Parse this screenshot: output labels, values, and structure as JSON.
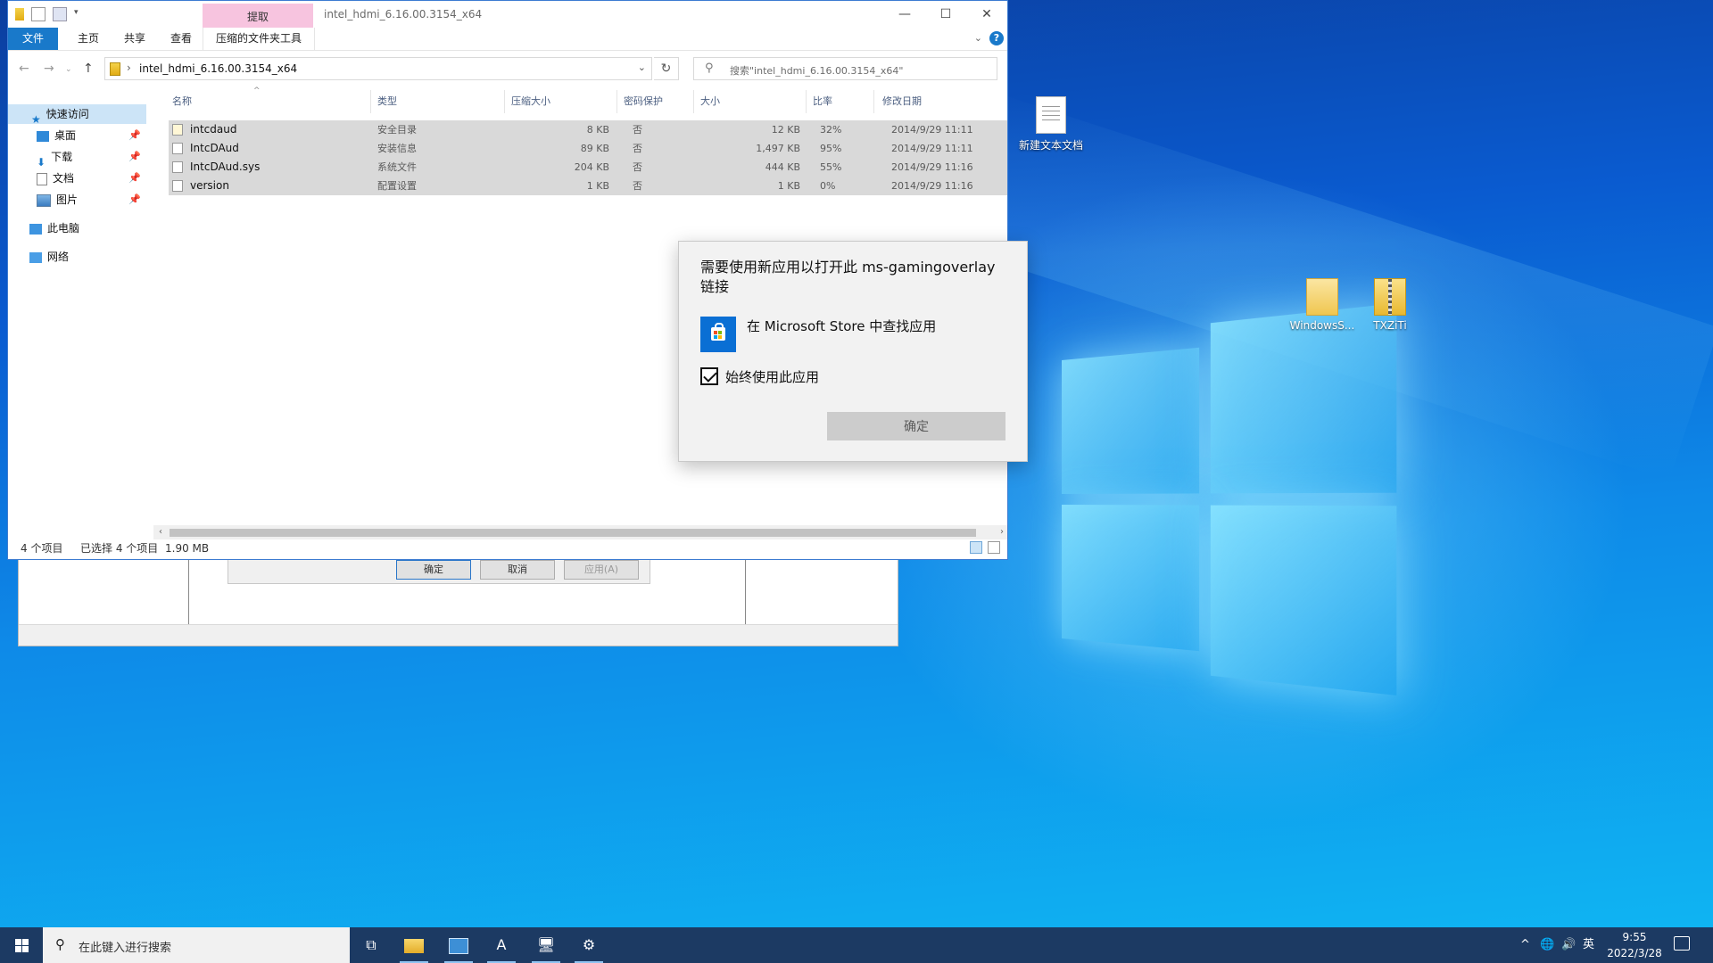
{
  "explorer": {
    "title": "intel_hdmi_6.16.00.3154_x64",
    "context_tab": "提取",
    "caption": {
      "minimize": "—",
      "maximize": "☐",
      "close": "✕"
    },
    "ribbon": {
      "file": "文件",
      "home": "主页",
      "share": "共享",
      "view": "查看",
      "compressed_tools": "压缩的文件夹工具",
      "help": "?"
    },
    "address": {
      "path": "intel_hdmi_6.16.00.3154_x64",
      "search_placeholder": "搜索\"intel_hdmi_6.16.00.3154_x64\""
    },
    "nav": {
      "quick_access": "快速访问",
      "desktop": "桌面",
      "downloads": "下载",
      "documents": "文档",
      "pictures": "图片",
      "this_pc": "此电脑",
      "network": "网络"
    },
    "columns": {
      "name": "名称",
      "type": "类型",
      "compressed_size": "压缩大小",
      "password": "密码保护",
      "size": "大小",
      "ratio": "比率",
      "modified": "修改日期"
    },
    "files": [
      {
        "name": "intcdaud",
        "type": "安全目录",
        "compressed": "8 KB",
        "password": "否",
        "size": "12 KB",
        "ratio": "32%",
        "modified": "2014/9/29 11:11"
      },
      {
        "name": "IntcDAud",
        "type": "安装信息",
        "compressed": "89 KB",
        "password": "否",
        "size": "1,497 KB",
        "ratio": "95%",
        "modified": "2014/9/29 11:11"
      },
      {
        "name": "IntcDAud.sys",
        "type": "系统文件",
        "compressed": "204 KB",
        "password": "否",
        "size": "444 KB",
        "ratio": "55%",
        "modified": "2014/9/29 11:16"
      },
      {
        "name": "version",
        "type": "配置设置",
        "compressed": "1 KB",
        "password": "否",
        "size": "1 KB",
        "ratio": "0%",
        "modified": "2014/9/29 11:16"
      }
    ],
    "status": {
      "count": "4 个项目",
      "selected": "已选择 4 个项目",
      "size": "1.90 MB"
    }
  },
  "back_dialog": {
    "ok": "确定",
    "cancel": "取消",
    "apply": "应用(A)"
  },
  "picker": {
    "title": "需要使用新应用以打开此 ms-gamingoverlay 链接",
    "store_option": "在 Microsoft Store 中查找应用",
    "always_use": "始终使用此应用",
    "always_use_checked": true,
    "ok": "确定"
  },
  "desktop": {
    "icons": [
      {
        "label": "新建文本文档"
      },
      {
        "label": "WindowsS..."
      },
      {
        "label": "TXZiTi"
      }
    ]
  },
  "taskbar": {
    "search_placeholder": "在此键入进行搜索",
    "ime": "英",
    "time": "9:55",
    "date": "2022/3/28"
  },
  "colors": {
    "accent": "#1979ca",
    "context_tab": "#f7c4df",
    "selection": "#d9d9d9",
    "taskbar": "#1c3a63"
  }
}
